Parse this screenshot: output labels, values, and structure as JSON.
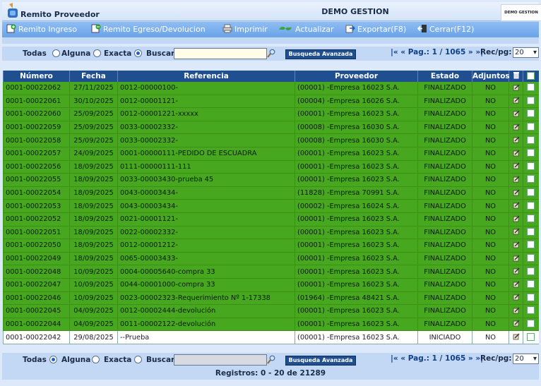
{
  "app": {
    "title": "Remito Proveedor",
    "company": "DEMO GESTION",
    "brand": "DEMO GESTION"
  },
  "toolbar": {
    "items": [
      {
        "label": "Remito Ingreso",
        "icon": "add-document-icon"
      },
      {
        "label": "Remito Egreso/Devolucion",
        "icon": "outgoing-document-icon"
      },
      {
        "label": "Imprimir",
        "icon": "printer-icon"
      },
      {
        "label": "Actualizar",
        "icon": "refresh-icon"
      },
      {
        "label": "Exportar(F8)",
        "icon": "export-icon"
      },
      {
        "label": "Cerrar(F12)",
        "icon": "close-door-icon"
      }
    ]
  },
  "filter": {
    "options": [
      "Todas",
      "Alguna",
      "Exacta",
      "Buscar"
    ],
    "top_selected": "Exacta",
    "bottom_selected": "Todas",
    "advanced_label": "Busqueda Avanzada",
    "pager_prefix": "|« « Pag.:",
    "page": "1 / 1065",
    "pager_suffix": "» »|",
    "recpg_label": "Rec/pg:",
    "recpg_value": "20"
  },
  "table": {
    "columns": [
      "Número",
      "Fecha",
      "Referencia",
      "Proveedor",
      "Estado",
      "Adjuntos"
    ],
    "rows": [
      [
        "0001-00022062",
        "27/11/2025",
        "0012-00000100-",
        "(00001) -Empresa 16023 S.A.",
        "FINALIZADO",
        "NO"
      ],
      [
        "0001-00022061",
        "30/10/2025",
        "0012-00001121-",
        "(00004) -Empresa 16026 S.A.",
        "FINALIZADO",
        "NO"
      ],
      [
        "0001-00022060",
        "25/09/2025",
        "0012-00001221-xxxxx",
        "(00001) -Empresa 16023 S.A.",
        "FINALIZADO",
        "NO"
      ],
      [
        "0001-00022059",
        "25/09/2025",
        "0033-00002332-",
        "(00008) -Empresa 16030 S.A.",
        "FINALIZADO",
        "NO"
      ],
      [
        "0001-00022058",
        "25/09/2025",
        "0033-00002332-",
        "(00008) -Empresa 16030 S.A.",
        "FINALIZADO",
        "NO"
      ],
      [
        "0001-00022057",
        "24/09/2025",
        "0001-00000111-PEDIDO DE ESCUADRA",
        "(00001) -Empresa 16023 S.A.",
        "FINALIZADO",
        "NO"
      ],
      [
        "0001-00022056",
        "18/09/2025",
        "0111-00000111-111",
        "(00001) -Empresa 16023 S.A.",
        "FINALIZADO",
        "NO"
      ],
      [
        "0001-00022055",
        "18/09/2025",
        "0033-00003430-prueba 45",
        "(00001) -Empresa 16023 S.A.",
        "FINALIZADO",
        "NO"
      ],
      [
        "0001-00022054",
        "18/09/2025",
        "0043-00003434-",
        "(11828) -Empresa 70991 S.A.",
        "FINALIZADO",
        "NO"
      ],
      [
        "0001-00022053",
        "18/09/2025",
        "0043-00003434-",
        "(00002) -Empresa 16024 S.A.",
        "FINALIZADO",
        "NO"
      ],
      [
        "0001-00022052",
        "18/09/2025",
        "0021-00001121-",
        "(00001) -Empresa 16023 S.A.",
        "FINALIZADO",
        "NO"
      ],
      [
        "0001-00022051",
        "18/09/2025",
        "0022-00002332-",
        "(00001) -Empresa 16023 S.A.",
        "FINALIZADO",
        "NO"
      ],
      [
        "0001-00022050",
        "18/09/2025",
        "0012-00001212-",
        "(00001) -Empresa 16023 S.A.",
        "FINALIZADO",
        "NO"
      ],
      [
        "0001-00022049",
        "18/09/2025",
        "0065-00003433-",
        "(00001) -Empresa 16023 S.A.",
        "FINALIZADO",
        "NO"
      ],
      [
        "0001-00022048",
        "10/09/2025",
        "0004-00005640-compra 33",
        "(00001) -Empresa 16023 S.A.",
        "FINALIZADO",
        "NO"
      ],
      [
        "0001-00022047",
        "10/09/2025",
        "0044-00001000-compra 33",
        "(00001) -Empresa 16023 S.A.",
        "FINALIZADO",
        "NO"
      ],
      [
        "0001-00022046",
        "10/09/2025",
        "0023-00002323-Requerimiento Nº 1-17338",
        "(01964) -Empresa 48421 S.A.",
        "FINALIZADO",
        "NO"
      ],
      [
        "0001-00022045",
        "04/09/2025",
        "0012-00002444-devolución",
        "(00001) -Empresa 16023 S.A.",
        "FINALIZADO",
        "NO"
      ],
      [
        "0001-00022044",
        "04/09/2025",
        "0011-00002122-devolución",
        "(00001) -Empresa 16023 S.A.",
        "FINALIZADO",
        "NO"
      ],
      [
        "0001-00022042",
        "29/08/2025",
        "--Prueba",
        "(00001) -Empresa 16023 S.A.",
        "INICIADO",
        "NO"
      ]
    ]
  },
  "footer": {
    "records": "Registros: 0 - 20 de 21289"
  },
  "colors": {
    "finalizado_row": "#47a71e",
    "header": "#1f4f8f",
    "toolbar": "#6aa3e8"
  }
}
